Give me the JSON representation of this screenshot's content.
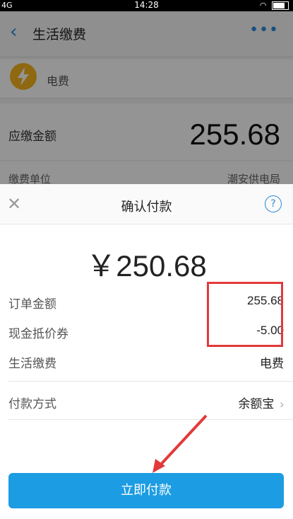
{
  "status_bar": {
    "network": "4G",
    "time": "14:28"
  },
  "page": {
    "back_icon": "chevron-left-icon",
    "title": "生活缴费",
    "more_icon": "ellipsis-icon",
    "bill_icon": "lightning-icon",
    "bill_type": "电费",
    "amount_due_label": "应缴金额",
    "amount_due": "255.68",
    "payee_label": "缴费单位",
    "payee_value": "潮安供电局"
  },
  "sheet": {
    "close_icon": "close-icon",
    "title": "确认付款",
    "help_icon": "question-icon",
    "help_symbol": "?",
    "amount": "￥250.68",
    "order_amount_label": "订单金额",
    "order_amount": "255.68",
    "coupon_label": "现金抵价券",
    "coupon_amount": "-5.00",
    "service_label": "生活缴费",
    "service_value": "电费",
    "method_label": "付款方式",
    "method_value": "余额宝",
    "pay_button": "立即付款"
  },
  "colors": {
    "accent": "#1c9ce3",
    "highlight": "#e23a3a",
    "bolt": "#f5b51e"
  }
}
